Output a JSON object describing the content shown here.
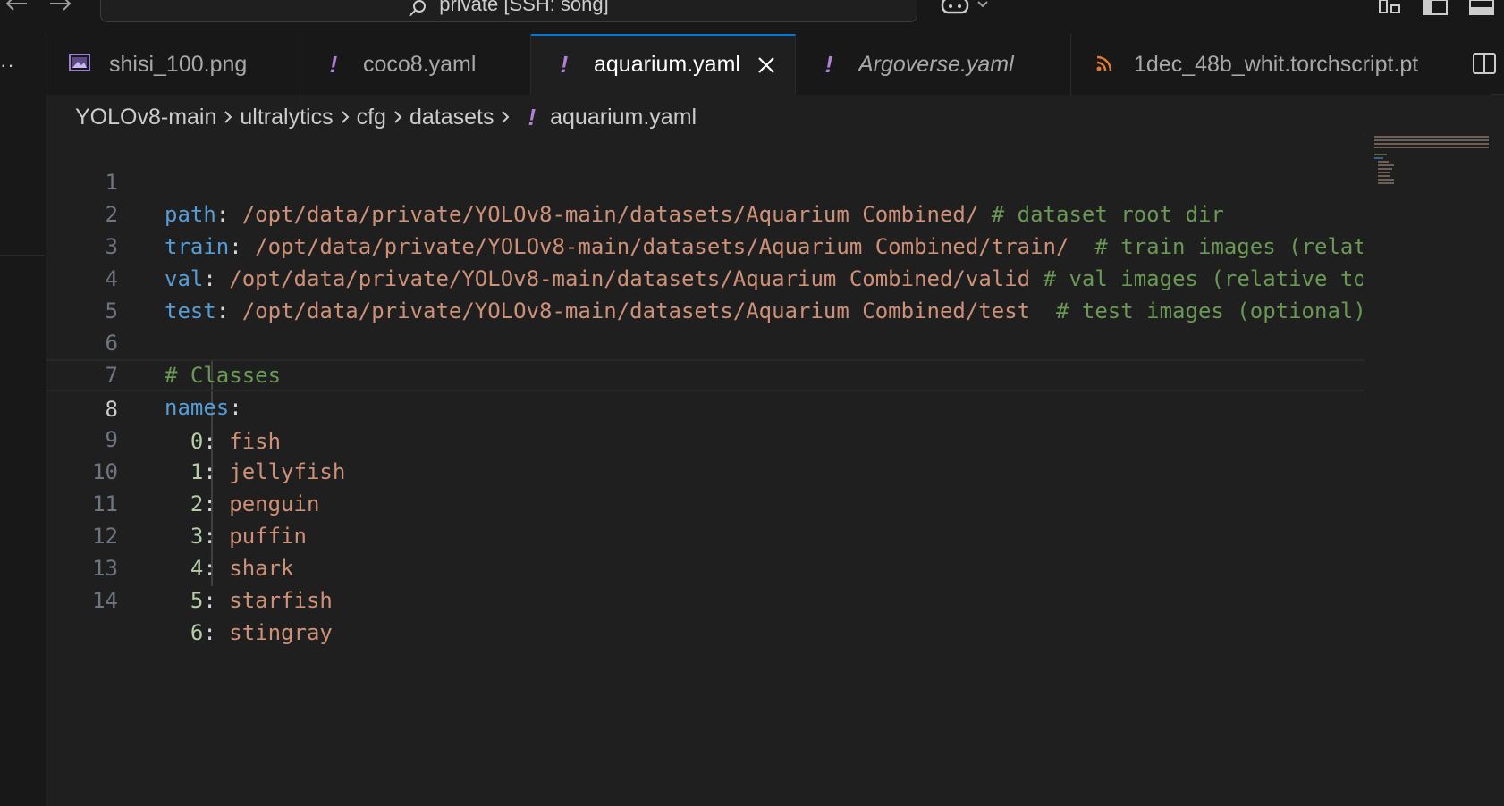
{
  "titlebar": {
    "command_center_text": "private [SSH: song]"
  },
  "tabs": [
    {
      "label": "shisi_100.png",
      "icon": "image-file-icon",
      "active": false,
      "italic": false
    },
    {
      "label": "coco8.yaml",
      "icon": "yaml-file-icon",
      "active": false,
      "italic": false
    },
    {
      "label": "aquarium.yaml",
      "icon": "yaml-file-icon",
      "active": true,
      "italic": false
    },
    {
      "label": "Argoverse.yaml",
      "icon": "yaml-file-icon",
      "active": false,
      "italic": true
    },
    {
      "label": "1dec_48b_whit.torchscript.pt",
      "icon": "rss-file-icon",
      "active": false,
      "italic": false
    }
  ],
  "breadcrumb": [
    "YOLOv8-main",
    "ultralytics",
    "cfg",
    "datasets",
    "aquarium.yaml"
  ],
  "editor": {
    "current_line": 8,
    "lines": [
      {
        "num": "1",
        "key": "path",
        "value": " /opt/data/private/YOLOv8-main/datasets/Aquarium Combined/",
        "comment": " # dataset root dir"
      },
      {
        "num": "2",
        "key": "train",
        "value": " /opt/data/private/YOLOv8-main/datasets/Aquarium Combined/train/",
        "comment": "  # train images (relat"
      },
      {
        "num": "3",
        "key": "val",
        "value": " /opt/data/private/YOLOv8-main/datasets/Aquarium Combined/valid",
        "comment": " # val images (relative to"
      },
      {
        "num": "4",
        "key": "test",
        "value": " /opt/data/private/YOLOv8-main/datasets/Aquarium Combined/test",
        "comment": "  # test images (optional)"
      },
      {
        "num": "5",
        "key": "",
        "value": "",
        "comment": ""
      },
      {
        "num": "6",
        "key": "",
        "value": "",
        "comment": "# Classes"
      },
      {
        "num": "7",
        "key": "names",
        "value": "",
        "comment": ""
      },
      {
        "num": "8",
        "idx": "0",
        "value": " fish"
      },
      {
        "num": "9",
        "idx": "1",
        "value": " jellyfish"
      },
      {
        "num": "10",
        "idx": "2",
        "value": " penguin"
      },
      {
        "num": "11",
        "idx": "3",
        "value": " puffin"
      },
      {
        "num": "12",
        "idx": "4",
        "value": " shark"
      },
      {
        "num": "13",
        "idx": "5",
        "value": " starfish"
      },
      {
        "num": "14",
        "idx": "6",
        "value": " stingray"
      }
    ]
  },
  "colors": {
    "key": "#569cd6",
    "string": "#ce9178",
    "comment": "#6a9955",
    "number": "#b5cea8",
    "accent": "#0078d4",
    "yaml_icon": "#b180d7",
    "rss_icon": "#e37933"
  }
}
